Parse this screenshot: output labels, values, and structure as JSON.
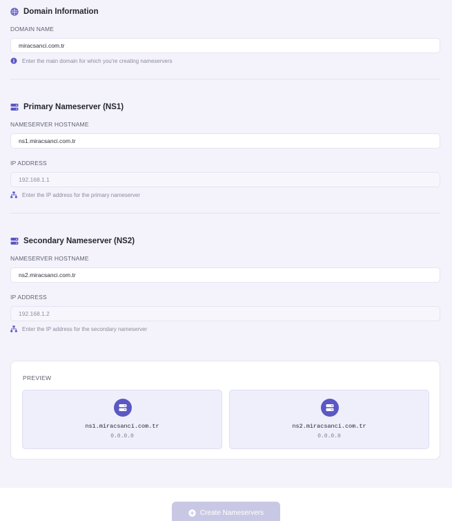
{
  "domain_section": {
    "title": "Domain Information",
    "icon": "globe-icon",
    "field_label": "DOMAIN NAME",
    "field_value": "miracsanci.com.tr",
    "hint": "Enter the main domain for which you're creating nameservers",
    "hint_icon": "info-icon"
  },
  "primary_section": {
    "title": "Primary Nameserver (NS1)",
    "icon": "server-icon",
    "hostname_label": "NAMESERVER HOSTNAME",
    "hostname_value": "ns1.miracsanci.com.tr",
    "ip_label": "IP ADDRESS",
    "ip_placeholder": "192.168.1.1",
    "hint": "Enter the IP address for the primary nameserver",
    "hint_icon": "network-icon"
  },
  "secondary_section": {
    "title": "Secondary Nameserver (NS2)",
    "icon": "server-icon",
    "hostname_label": "NAMESERVER HOSTNAME",
    "hostname_value": "ns2.miracsanci.com.tr",
    "ip_label": "IP ADDRESS",
    "ip_placeholder": "192.168.1.2",
    "hint": "Enter the IP address for the secondary nameserver",
    "hint_icon": "network-icon"
  },
  "preview": {
    "title": "PREVIEW",
    "ns1": {
      "host": "ns1.miracsanci.com.tr",
      "ip": "0.0.0.0"
    },
    "ns2": {
      "host": "ns2.miracsanci.com.tr",
      "ip": "0.0.0.0"
    }
  },
  "submit": {
    "label": "Create Nameservers",
    "icon": "plus-circle-icon",
    "state": "disabled"
  },
  "colors": {
    "accent": "#5b57c3",
    "panel_background": "#f4f3fc",
    "button_disabled": "#c9c8e4"
  }
}
